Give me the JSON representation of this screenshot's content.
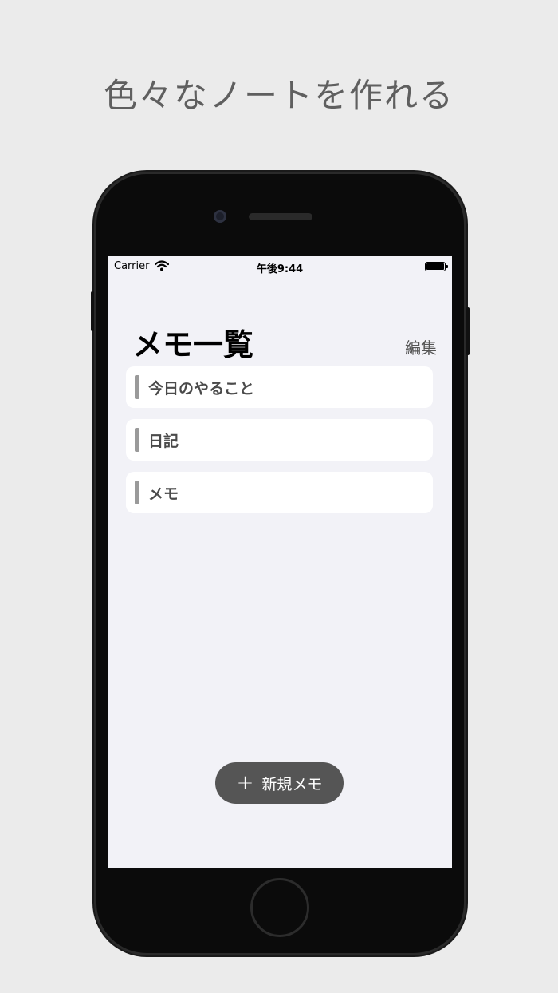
{
  "headline": "色々なノートを作れる",
  "status_bar": {
    "carrier": "Carrier",
    "time": "午後9:44"
  },
  "nav": {
    "title": "メモ一覧",
    "edit_label": "編集"
  },
  "notes": [
    {
      "label": "今日のやること"
    },
    {
      "label": "日記"
    },
    {
      "label": "メモ"
    }
  ],
  "new_button": {
    "icon": "+",
    "label": "新規メモ"
  },
  "colors": {
    "background": "#ebebeb",
    "screen": "#f2f2f7",
    "button": "#555555",
    "accent_bar": "#9a9a9a"
  }
}
